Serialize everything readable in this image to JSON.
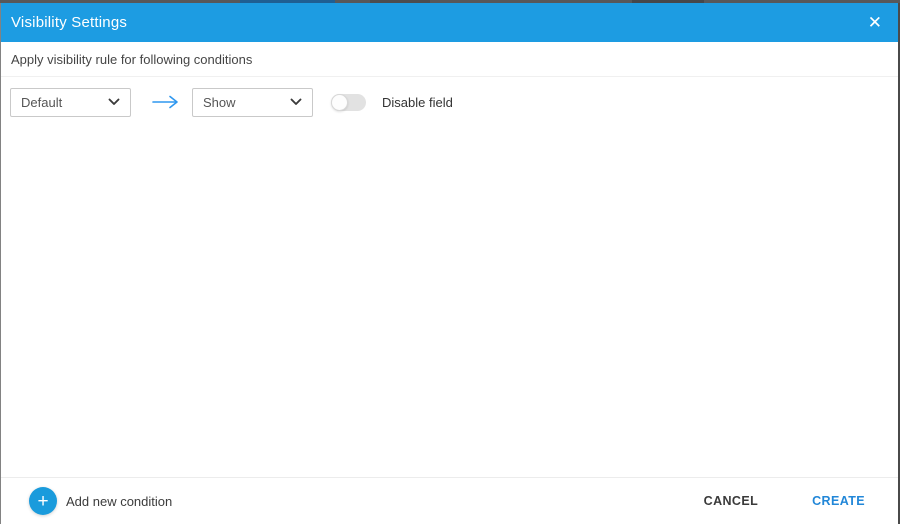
{
  "header": {
    "title": "Visibility Settings"
  },
  "icons": {
    "close": "✕",
    "plus": "+",
    "chevron_down": "chevron-down-icon",
    "arrow_right": "arrow-right-icon"
  },
  "colors": {
    "header_blue": "#1d9ce2",
    "accent_blue": "#2287d8",
    "arrow_blue": "#2e97ef",
    "add_button_blue": "#1a9bdc",
    "toggle_track": "#e2e2e2"
  },
  "subheader": {
    "text": "Apply visibility rule for following conditions"
  },
  "condition_row": {
    "field_select": {
      "value": "Default"
    },
    "action_select": {
      "value": "Show"
    },
    "disable_toggle": {
      "state": "off"
    },
    "disable_label": "Disable field"
  },
  "footer": {
    "add_condition_label": "Add new condition",
    "cancel_label": "CANCEL",
    "create_label": "CREATE"
  }
}
